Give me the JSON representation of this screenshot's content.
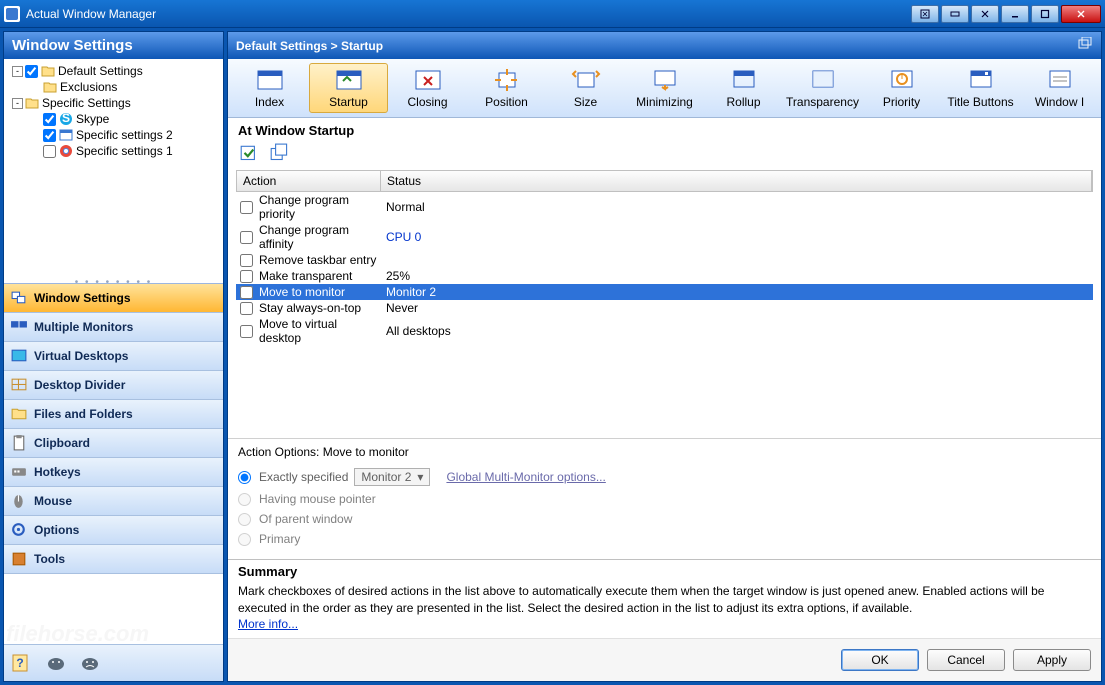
{
  "titlebar": {
    "title": "Actual Window Manager"
  },
  "sidebar": {
    "header": "Window Settings",
    "tree": [
      {
        "label": "Default Settings",
        "indent": 0,
        "twist": "-",
        "checked": true,
        "icon": "folder"
      },
      {
        "label": "Exclusions",
        "indent": 1,
        "twist": "",
        "checked": null,
        "icon": "folder"
      },
      {
        "label": "Specific Settings",
        "indent": 0,
        "twist": "-",
        "checked": null,
        "icon": "folder"
      },
      {
        "label": "Skype",
        "indent": 1,
        "twist": "",
        "checked": true,
        "icon": "skype"
      },
      {
        "label": "Specific settings 2",
        "indent": 1,
        "twist": "",
        "checked": true,
        "icon": "app"
      },
      {
        "label": "Specific settings 1",
        "indent": 1,
        "twist": "",
        "checked": false,
        "icon": "chrome"
      }
    ],
    "nav": [
      {
        "label": "Window Settings",
        "icon": "windows",
        "active": true
      },
      {
        "label": "Multiple Monitors",
        "icon": "monitors",
        "active": false
      },
      {
        "label": "Virtual Desktops",
        "icon": "vdesktop",
        "active": false
      },
      {
        "label": "Desktop Divider",
        "icon": "divider",
        "active": false
      },
      {
        "label": "Files and Folders",
        "icon": "folders",
        "active": false
      },
      {
        "label": "Clipboard",
        "icon": "clipboard",
        "active": false
      },
      {
        "label": "Hotkeys",
        "icon": "hotkeys",
        "active": false
      },
      {
        "label": "Mouse",
        "icon": "mouse",
        "active": false
      },
      {
        "label": "Options",
        "icon": "options",
        "active": false
      },
      {
        "label": "Tools",
        "icon": "tools",
        "active": false
      }
    ]
  },
  "content": {
    "breadcrumb": "Default Settings > Startup",
    "toolbar": [
      {
        "label": "Index"
      },
      {
        "label": "Startup",
        "active": true
      },
      {
        "label": "Closing"
      },
      {
        "label": "Position"
      },
      {
        "label": "Size"
      },
      {
        "label": "Minimizing"
      },
      {
        "label": "Rollup"
      },
      {
        "label": "Transparency"
      },
      {
        "label": "Priority"
      },
      {
        "label": "Title Buttons"
      },
      {
        "label": "Window I"
      }
    ],
    "section_title": "At Window Startup",
    "grid": {
      "headers": {
        "c1": "Action",
        "c2": "Status"
      },
      "rows": [
        {
          "action": "Change program priority",
          "status": "Normal",
          "checked": false,
          "selected": false
        },
        {
          "action": "Change program affinity",
          "status": "CPU 0",
          "checked": false,
          "selected": false,
          "link": true
        },
        {
          "action": "Remove taskbar entry",
          "status": "",
          "checked": false,
          "selected": false
        },
        {
          "action": "Make transparent",
          "status": "25%",
          "checked": false,
          "selected": false
        },
        {
          "action": "Move to monitor",
          "status": "Monitor 2",
          "checked": false,
          "selected": true
        },
        {
          "action": "Stay always-on-top",
          "status": "Never",
          "checked": false,
          "selected": false
        },
        {
          "action": "Move to virtual desktop",
          "status": "All desktops",
          "checked": false,
          "selected": false
        }
      ]
    },
    "options": {
      "title": "Action Options: Move to monitor",
      "exactly_label": "Exactly specified",
      "monitor_value": "Monitor 2",
      "gmm_link": "Global Multi-Monitor options...",
      "having_mouse": "Having mouse pointer",
      "of_parent": "Of parent window",
      "primary": "Primary"
    },
    "summary": {
      "title": "Summary",
      "body": "Mark checkboxes of desired actions in the list above to automatically execute them when the target window is just opened anew. Enabled actions will be executed in the order as they are presented in the list. Select the desired action in the list to adjust its extra options, if available.",
      "more": "More info..."
    },
    "buttons": {
      "ok": "OK",
      "cancel": "Cancel",
      "apply": "Apply"
    }
  },
  "watermark": "filehorse.com"
}
